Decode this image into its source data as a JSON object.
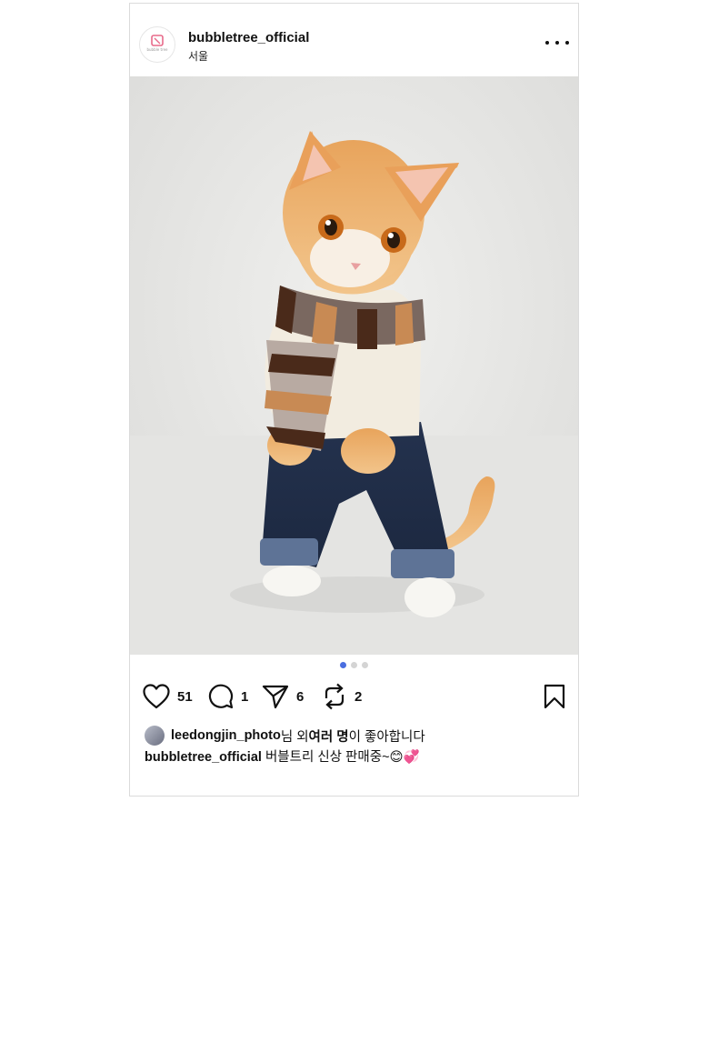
{
  "post": {
    "username": "bubbletree_official",
    "location": "서울",
    "avatar_text": "bubble tree",
    "carousel": {
      "count": 3,
      "active_index": 0
    },
    "colors": {
      "accent": "#4a6ee0",
      "border": "#dbdbdb"
    }
  },
  "actions": {
    "like_count": "51",
    "comment_count": "1",
    "share_count": "6",
    "repost_count": "2"
  },
  "likes": {
    "user": "leedongjin_photo",
    "text_1": "님 외 ",
    "text_bold": "여러 명",
    "text_2": "이 좋아합니다"
  },
  "caption": {
    "user": "bubbletree_official",
    "text": " 버블트리 신상 판매중~😊💞"
  }
}
